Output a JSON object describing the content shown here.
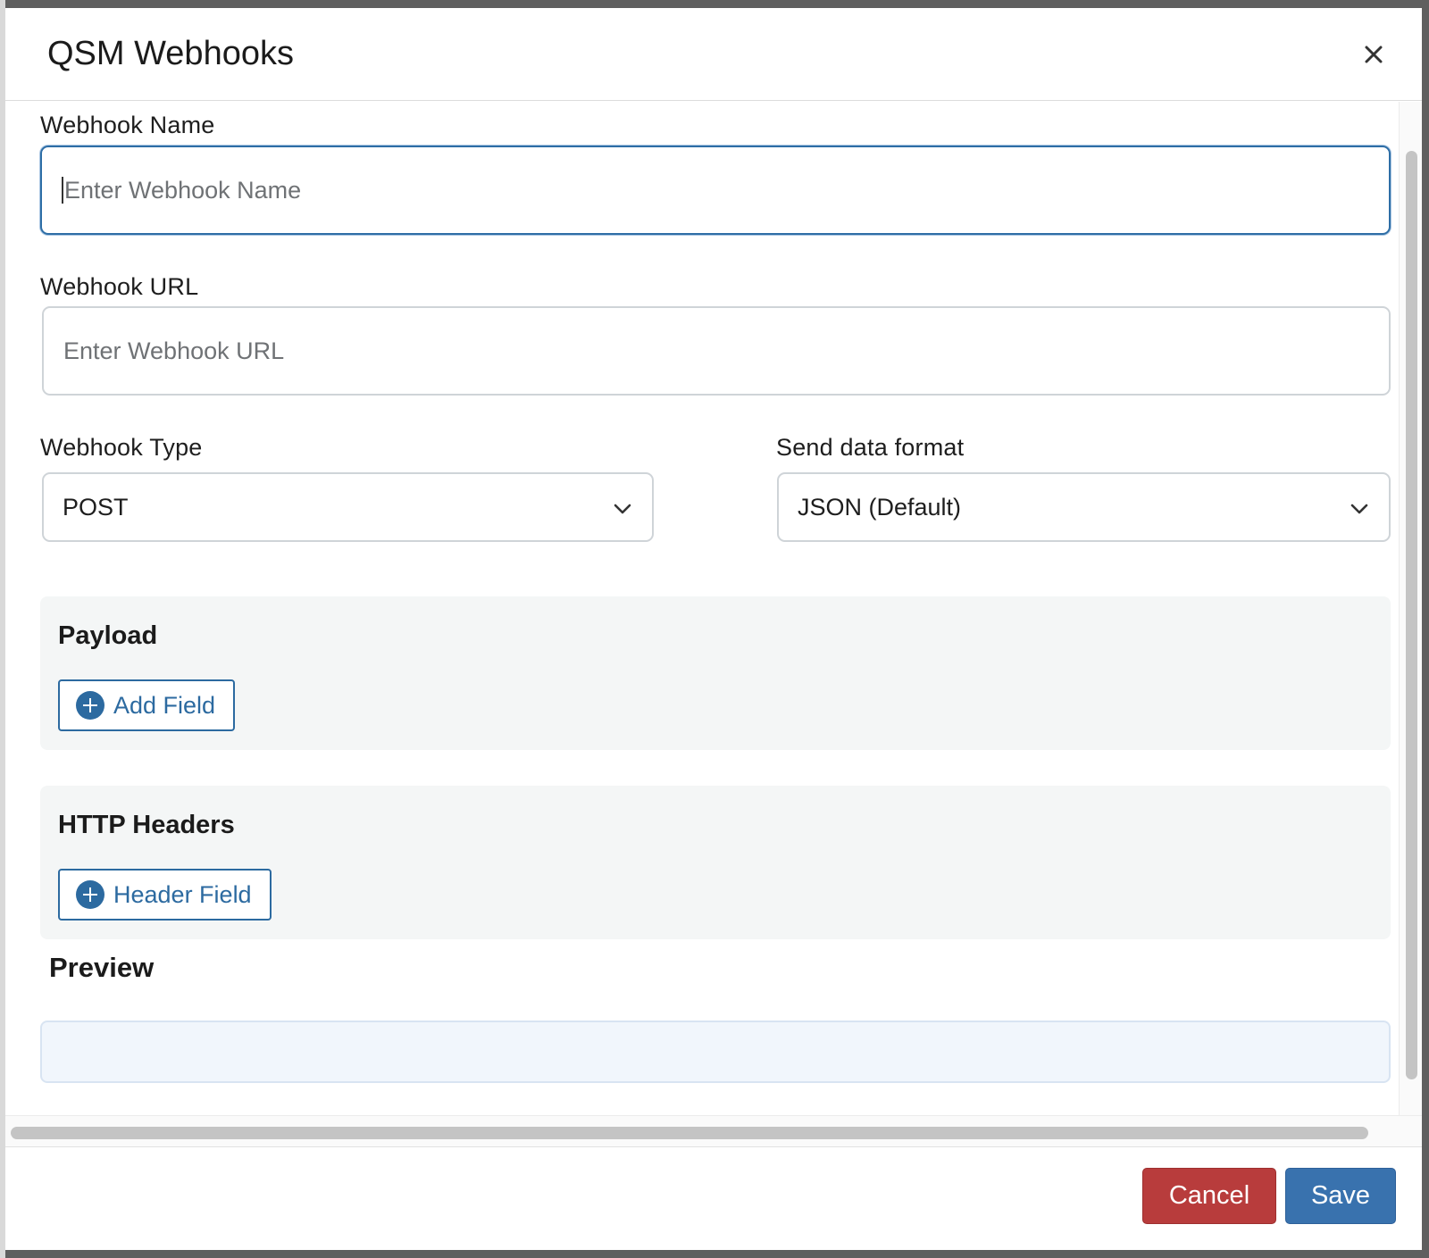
{
  "modal": {
    "title": "QSM Webhooks"
  },
  "form": {
    "webhook_name": {
      "label": "Webhook Name",
      "placeholder": "Enter Webhook Name",
      "value": ""
    },
    "webhook_url": {
      "label": "Webhook URL",
      "placeholder": "Enter Webhook URL",
      "value": ""
    },
    "webhook_type": {
      "label": "Webhook Type",
      "selected": "POST"
    },
    "data_format": {
      "label": "Send data format",
      "selected": "JSON (Default)"
    }
  },
  "payload": {
    "title": "Payload",
    "add_button": "Add Field"
  },
  "headers": {
    "title": "HTTP Headers",
    "add_button": "Header Field"
  },
  "preview": {
    "title": "Preview",
    "content": ""
  },
  "footer": {
    "cancel_label": "Cancel",
    "save_label": "Save"
  },
  "colors": {
    "primary": "#2c6aa0",
    "save": "#3972ae",
    "cancel": "#b83c3c",
    "panel_bg": "#f4f6f6",
    "preview_bg": "#f1f6fc"
  },
  "icons": {
    "close": "close-icon",
    "dropdown": "chevron-down-icon",
    "add": "plus-circle-icon"
  }
}
